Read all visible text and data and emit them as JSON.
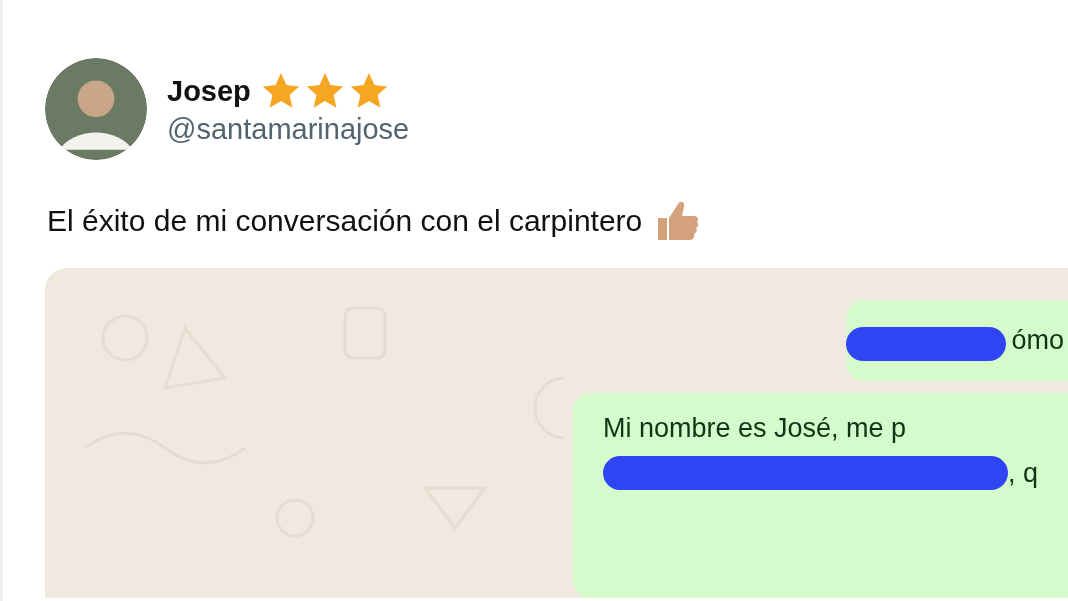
{
  "author": {
    "name": "Josep",
    "stars": 3,
    "handle": "@santamarinajose"
  },
  "tweet": {
    "text": "El éxito de mi conversación con el carpintero"
  },
  "chat": {
    "messages": [
      {
        "lines": [
          "ómo"
        ]
      },
      {
        "lines": [
          "Mi nombre es José, me p",
          ", q"
        ]
      }
    ]
  }
}
